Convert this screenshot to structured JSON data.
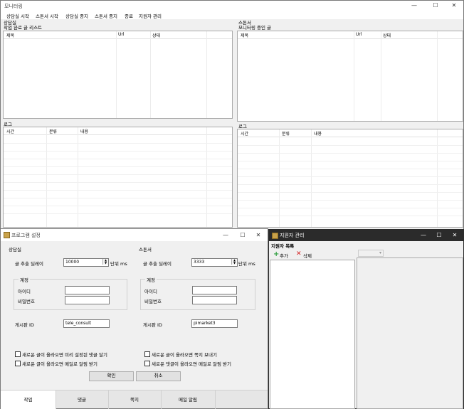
{
  "monitor": {
    "title": "모니터링",
    "menu": [
      "상담실 시작",
      "스톤서 시작",
      "상담실 중지",
      "스톤서 중지",
      "종료",
      "지원자 관리"
    ],
    "left_section": "상담실",
    "right_section": "스톤서",
    "left_list_title": "작업 완료 글 리스트",
    "right_list_title": "모니터링 중인 글",
    "list_columns": [
      "제목",
      "Url",
      "상태"
    ],
    "log_title": "로그",
    "log_columns": [
      "시간",
      "분류",
      "내용"
    ]
  },
  "settings": {
    "title": "프로그램 설정",
    "left_group": "상담실",
    "right_group": "스톤서",
    "delay_label": "글 추출 딜레이",
    "left_delay": "10000",
    "right_delay": "3333",
    "unit_label": "단위 ms",
    "account_group": "계정",
    "id_label": "아이디",
    "pw_label": "비밀번호",
    "board_label": "게시판 ID",
    "left_board": "tele_consult",
    "right_board": "pimarket3",
    "left_checks": [
      "새로운 글이 올라오면 미리 설정된 댓글 달기",
      "새로운 글이 올라오면 메일로 알림 받기"
    ],
    "right_checks": [
      "새로운 글이 올라오면 쪽지 보내기",
      "새로운 댓글이 올라오면 메일로 알림 받기"
    ],
    "ok_label": "확인",
    "cancel_label": "취소",
    "tabs": [
      "작업",
      "댓글",
      "쪽지",
      "메일 알림"
    ]
  },
  "applicants": {
    "title": "지원자 관리",
    "list_title": "지원자 목록",
    "add_label": "추가",
    "delete_label": "삭제"
  },
  "window_buttons": {
    "minimize": "—",
    "maximize": "☐",
    "close": "✕"
  },
  "colors": {
    "accent_add": "#2e9e3e",
    "accent_delete": "#d42020",
    "dark_titlebar": "#2b2b2b"
  }
}
